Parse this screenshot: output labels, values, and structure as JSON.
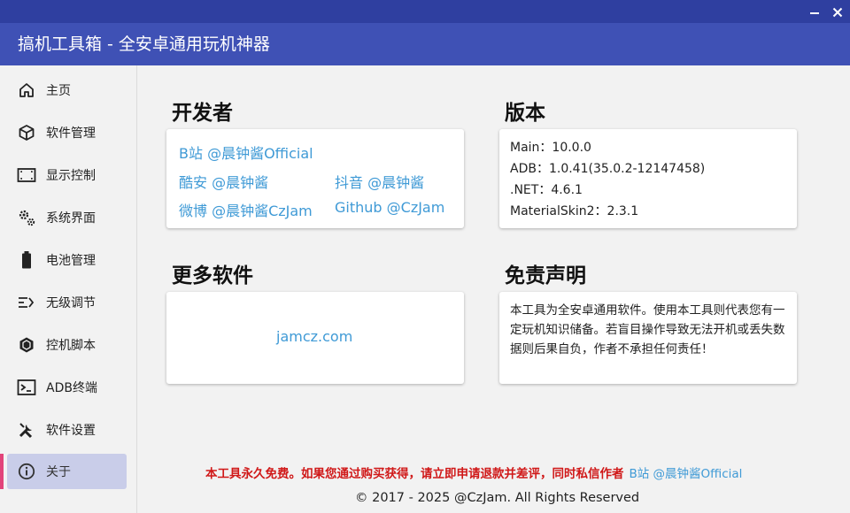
{
  "window": {
    "title": "搞机工具箱 - 全安卓通用玩机神器"
  },
  "sidebar": {
    "items": [
      {
        "label": "主页",
        "icon": "home-icon"
      },
      {
        "label": "软件管理",
        "icon": "package-icon"
      },
      {
        "label": "显示控制",
        "icon": "screen-icon"
      },
      {
        "label": "系统界面",
        "icon": "gears-icon"
      },
      {
        "label": "电池管理",
        "icon": "battery-icon"
      },
      {
        "label": "无级调节",
        "icon": "adjust-icon"
      },
      {
        "label": "控机脚本",
        "icon": "hexagon-icon"
      },
      {
        "label": "ADB终端",
        "icon": "terminal-icon"
      },
      {
        "label": "软件设置",
        "icon": "tools-icon"
      },
      {
        "label": "关于",
        "icon": "info-icon",
        "active": true
      }
    ]
  },
  "developer": {
    "title": "开发者",
    "bilibili": "B站 @晨钟酱Official",
    "coolapk": "酷安 @晨钟酱",
    "douyin": "抖音 @晨钟酱",
    "weibo": "微博 @晨钟酱CzJam",
    "github": "Github @CzJam"
  },
  "version": {
    "title": "版本",
    "lines": [
      "Main：10.0.0",
      "ADB：1.0.41(35.0.2-12147458)",
      ".NET：4.6.1",
      "MaterialSkin2：2.3.1"
    ]
  },
  "more_software": {
    "title": "更多软件",
    "link": "jamcz.com"
  },
  "disclaimer": {
    "title": "免责声明",
    "text": "本工具为全安卓通用软件。使用本工具则代表您有一定玩机知识储备。若盲目操作导致无法开机或丢失数据则后果自负，作者不承担任何责任！"
  },
  "footer": {
    "notice": "本工具永久免费。如果您通过购买获得，请立即申请退款并差评，同时私信作者",
    "notice_link": "B站 @晨钟酱Official",
    "copyright": "© 2017 - 2025 @CzJam. All Rights Reserved"
  },
  "colors": {
    "titlebar": "#3f51b5",
    "topstrip": "#2f3fa0",
    "link": "#3f9ad6",
    "warning": "#d01818",
    "active_item": "#c9cde9",
    "active_bar": "#e2447a"
  }
}
